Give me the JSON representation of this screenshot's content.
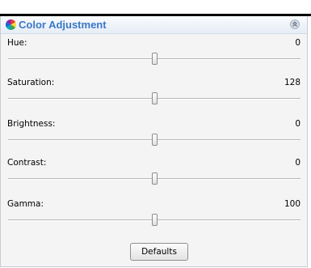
{
  "panel": {
    "title": "Color Adjustment",
    "title_icon": "color-wheel-icon",
    "collapse_icon": "collapse-chevron-up-icon"
  },
  "sliders": [
    {
      "label": "Hue:",
      "value": "0",
      "min": -180,
      "max": 180,
      "current": 0
    },
    {
      "label": "Saturation:",
      "value": "128",
      "min": 0,
      "max": 256,
      "current": 128
    },
    {
      "label": "Brightness:",
      "value": "0",
      "min": -255,
      "max": 255,
      "current": 0
    },
    {
      "label": "Contrast:",
      "value": "0",
      "min": -100,
      "max": 100,
      "current": 0
    },
    {
      "label": "Gamma:",
      "value": "100",
      "min": 0,
      "max": 200,
      "current": 100
    }
  ],
  "defaults_button": {
    "label": "Defaults"
  },
  "colors": {
    "title": "#3a78c8",
    "panel_bg": "#f4f4f4"
  }
}
